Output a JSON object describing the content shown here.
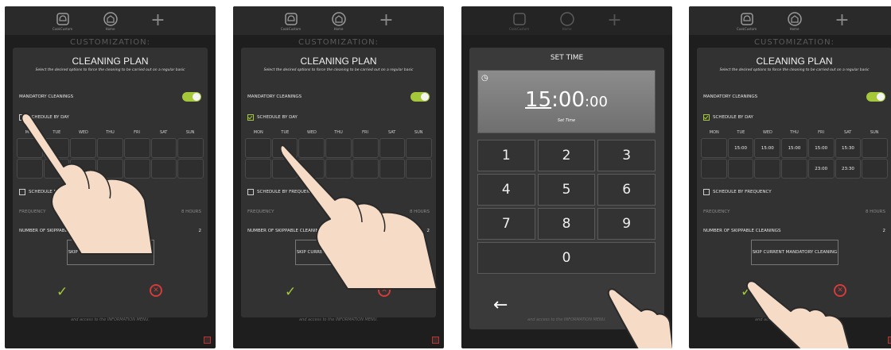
{
  "nav": {
    "customize_label": "CookCustom",
    "home_label": "Home",
    "plus": "+"
  },
  "bg_title": "CUSTOMIZATION:",
  "footnote": "and access to the INFORMATION MENU.",
  "modal": {
    "title": "CLEANING PLAN",
    "subtitle": "Select the desired options to force the cleaning to be carried out on a regular basic",
    "mandatory": "MANDATORY CLEANINGS",
    "schedule_by_day": "SCHEDULE BY DAY",
    "days": [
      "MON",
      "TUE",
      "WED",
      "THU",
      "FRI",
      "SAT",
      "SUN"
    ],
    "schedule_by_frequency": "SCHEDULE BY FREQUENCY",
    "frequency": "FREQUENCY",
    "frequency_value": "8 HOURS",
    "skippable": "NUMBER OF SKIPPABLE CLEANINGS",
    "skippable_value": "2",
    "skip_btn": "SKIP CURRENT MANDATORY CLEANING",
    "ok": "✓",
    "cancel": "✕"
  },
  "filled_times": {
    "row1": [
      "",
      "15:00",
      "15:00",
      "15:00",
      "15:00",
      "15:30",
      ""
    ],
    "row2": [
      "",
      "",
      "",
      "",
      "23:00",
      "23:30",
      ""
    ]
  },
  "keypad": {
    "title": "SET TIME",
    "time_hh": "15",
    "time_mm": ":00",
    "time_ss": ":00",
    "set_time_label": "Set Time",
    "keys": [
      "1",
      "2",
      "3",
      "4",
      "5",
      "6",
      "7",
      "8",
      "9",
      "0"
    ],
    "back": "←",
    "ok": "✓"
  }
}
